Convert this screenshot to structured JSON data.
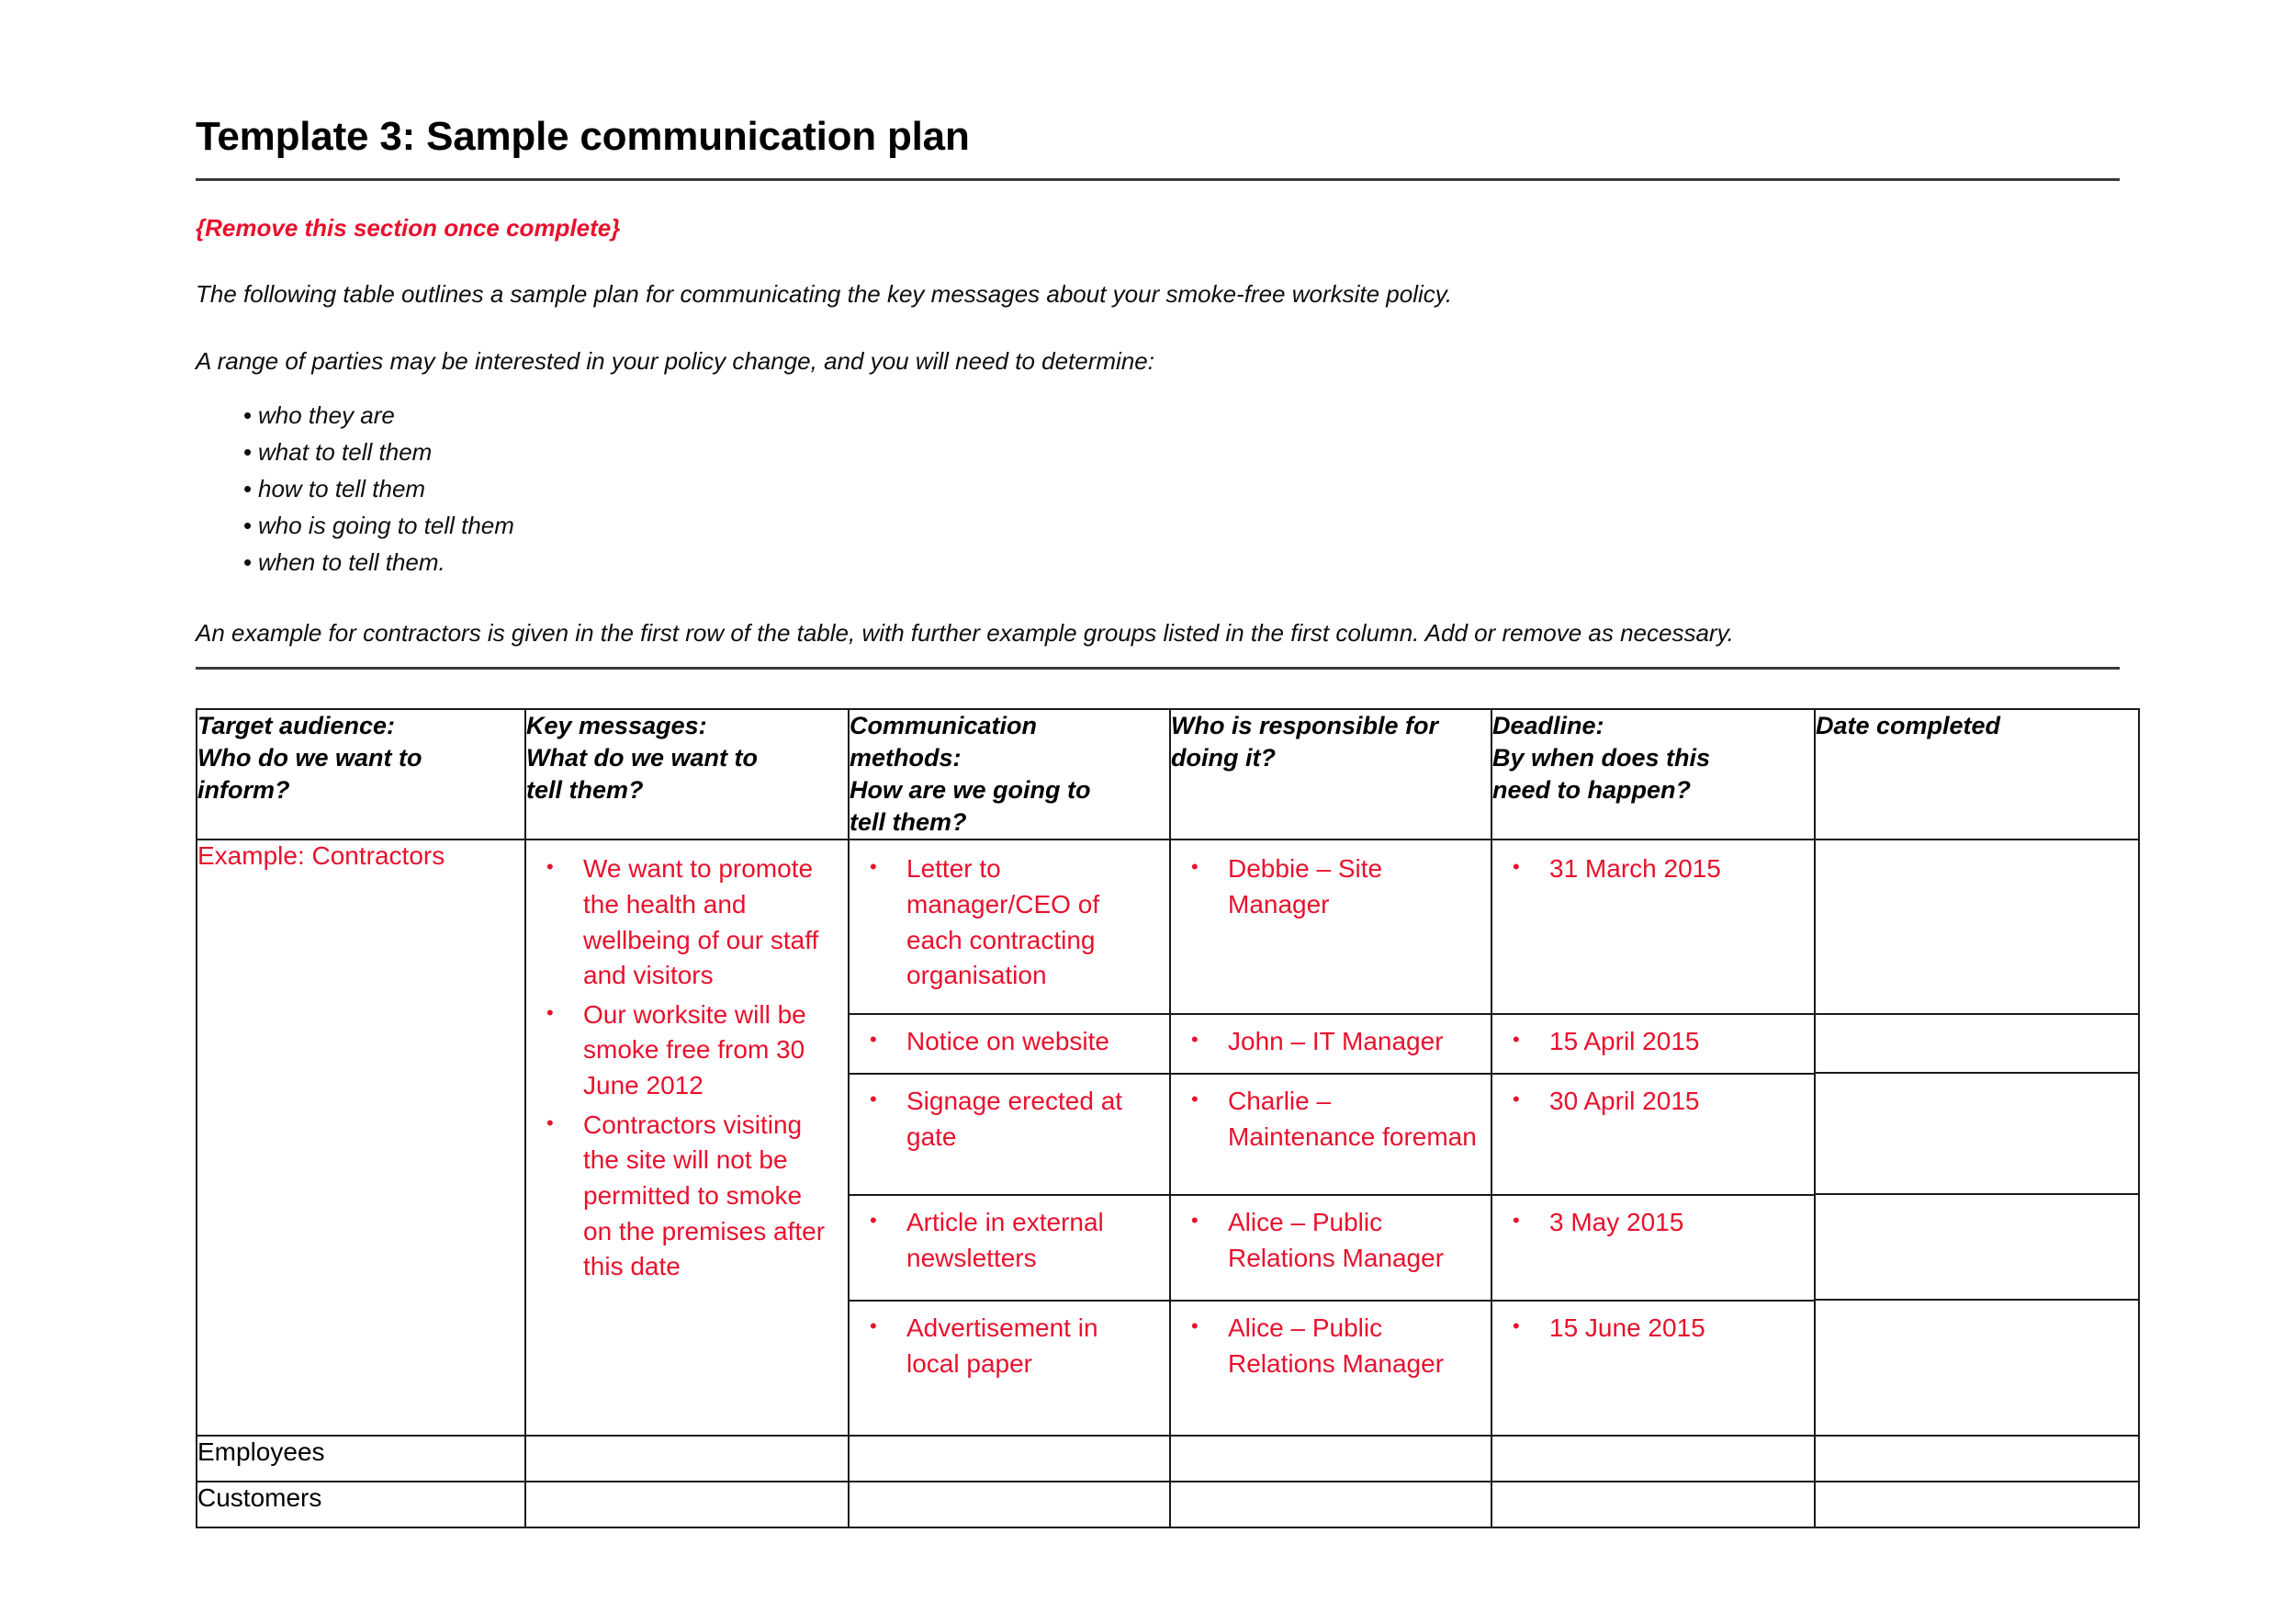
{
  "document": {
    "title": "Template 3: Sample communication plan",
    "remove_note": "{Remove this section once complete}",
    "intro_paragraph_1": "The following table outlines a sample plan for communicating the key messages about your smoke-free worksite policy.",
    "intro_paragraph_2": "A range of parties may be interested in your policy change, and you will need to determine:",
    "bullets": [
      "who they are",
      "what to tell them",
      "how to tell them",
      "who is going to tell them",
      "when to tell them."
    ],
    "bullet_glyph": "•",
    "closing_paragraph": "An example for contractors is given in the first row of the table, with further example groups listed in the first column. Add or remove as necessary."
  },
  "colors": {
    "red_accent": "#e8112d",
    "text": "#000000",
    "rule": "#3a3a3a",
    "table_border": "#1a1a1a"
  },
  "table": {
    "headers": [
      {
        "line1": "Target audience:",
        "line2": "Who do we want to",
        "line3": "inform?"
      },
      {
        "line1": "Key messages:",
        "line2": "What do we want to",
        "line3": "tell them?"
      },
      {
        "line1": "Communication",
        "line2": "methods:",
        "line3": "How are we going to",
        "line4": "tell them?"
      },
      {
        "line1": "Who is responsible for",
        "line2": "doing it?"
      },
      {
        "line1": "Deadline:",
        "line2": "By when does this",
        "line3": "need to happen?"
      },
      {
        "line1": "Date completed"
      }
    ],
    "example_row": {
      "target_audience": "Example: Contractors",
      "key_messages": [
        "We want to promote the health and wellbeing of our staff and visitors",
        "Our worksite will be smoke free from 30 June 2012",
        "Contractors visiting the site will not be permitted to smoke on the premises after this date"
      ],
      "entries": [
        {
          "communication_method": "Letter to manager/CEO of each contracting organisation",
          "responsible": "Debbie – Site Manager",
          "deadline": "31 March 2015",
          "date_completed": ""
        },
        {
          "communication_method": "Notice on website",
          "responsible": "John – IT Manager",
          "deadline": "15 April 2015",
          "date_completed": ""
        },
        {
          "communication_method": "Signage erected at gate",
          "responsible": "Charlie – Maintenance foreman",
          "deadline": "30 April 2015",
          "date_completed": ""
        },
        {
          "communication_method": "Article in external newsletters",
          "responsible": "Alice – Public Relations Manager",
          "deadline": "3 May 2015",
          "date_completed": ""
        },
        {
          "communication_method": "Advertisement in local paper",
          "responsible": "Alice – Public Relations Manager",
          "deadline": "15 June 2015",
          "date_completed": ""
        }
      ]
    },
    "blank_rows": [
      {
        "target_audience": "Employees",
        "key_messages": "",
        "communication_method": "",
        "responsible": "",
        "deadline": "",
        "date_completed": ""
      },
      {
        "target_audience": "Customers",
        "key_messages": "",
        "communication_method": "",
        "responsible": "",
        "deadline": "",
        "date_completed": ""
      }
    ]
  }
}
